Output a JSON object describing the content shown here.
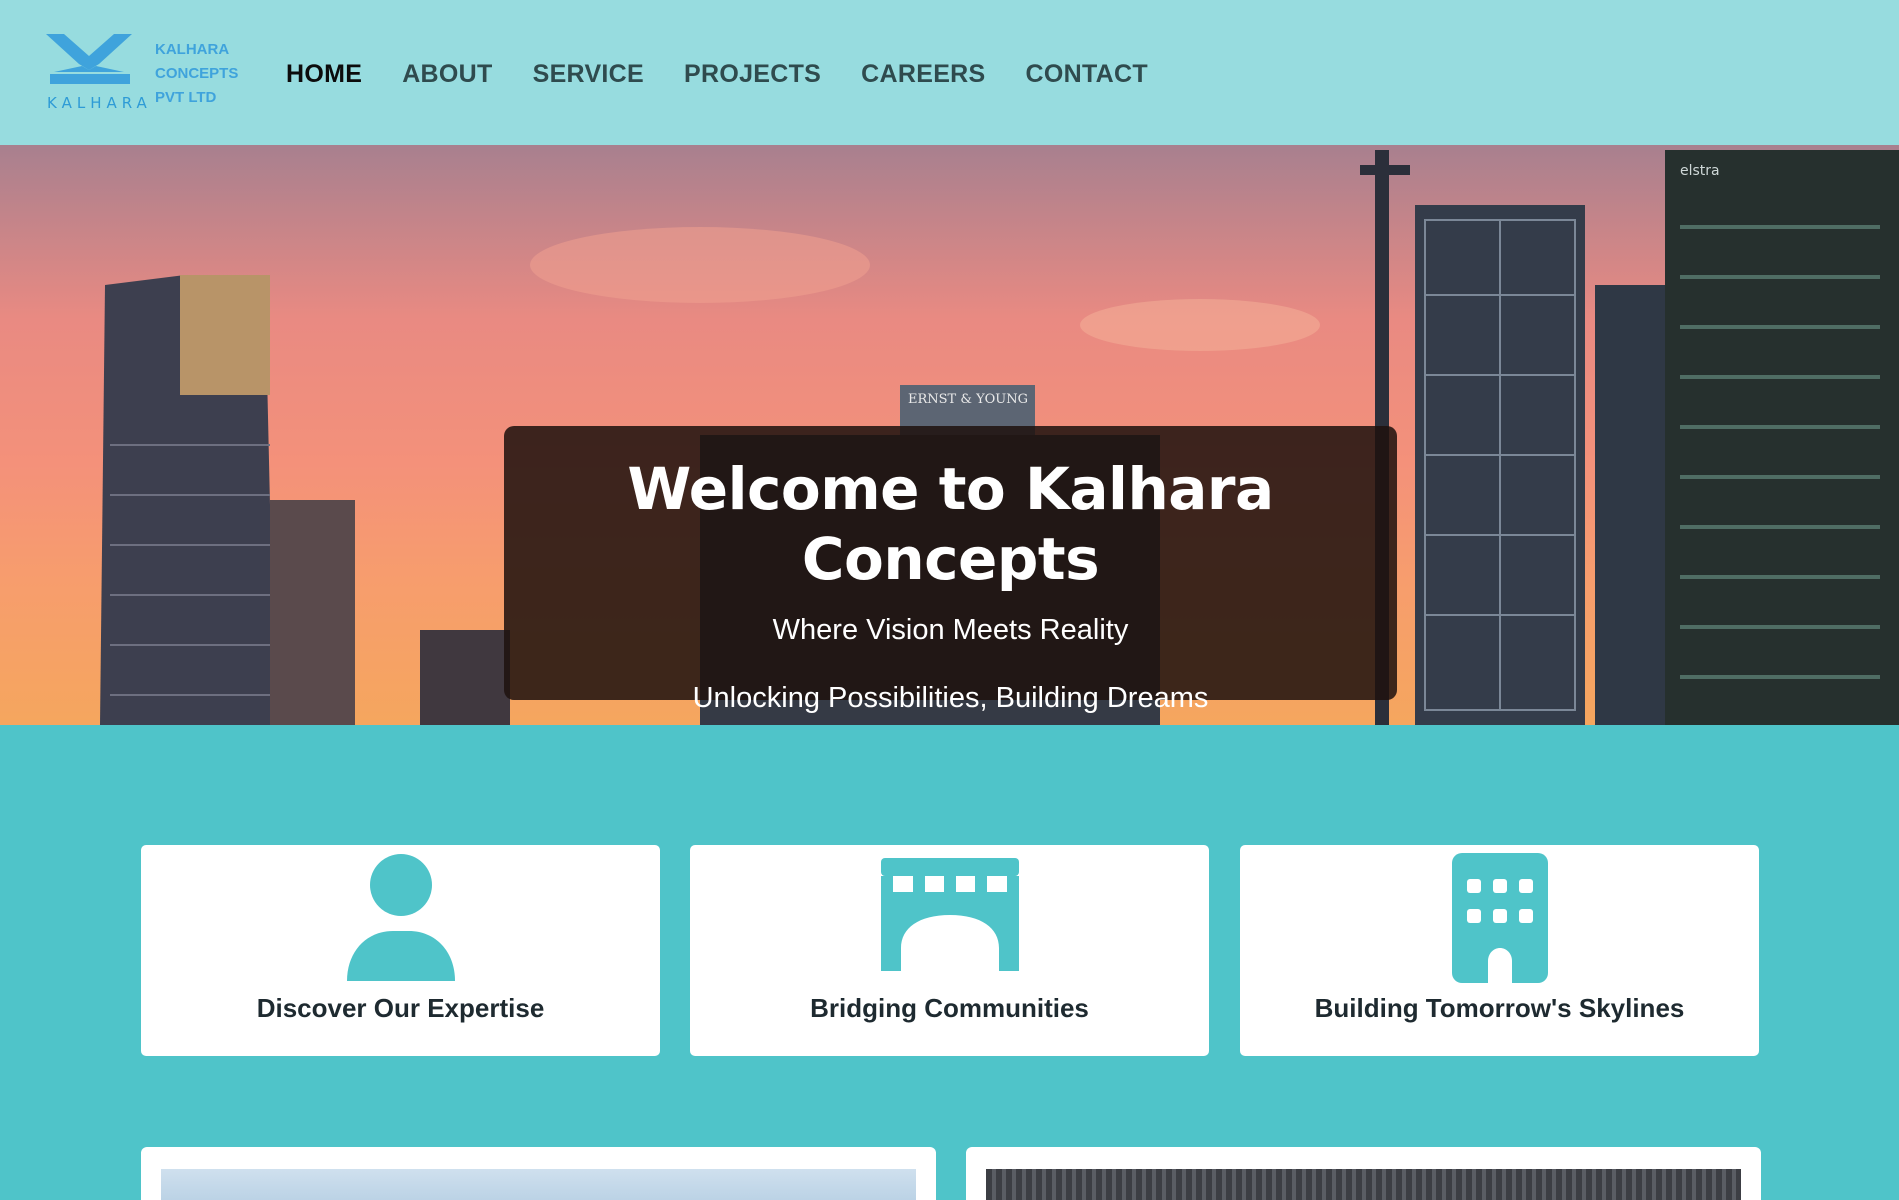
{
  "brand": {
    "logo_word": "KALHARA",
    "company_lines": [
      "KALHARA",
      "CONCEPTS",
      "PVT LTD"
    ],
    "logo_icon": "kalhara-x-mark-icon",
    "accent": "#3fa3dc"
  },
  "nav": {
    "items": [
      {
        "label": "HOME",
        "active": true
      },
      {
        "label": "ABOUT",
        "active": false
      },
      {
        "label": "SERVICE",
        "active": false
      },
      {
        "label": "PROJECTS",
        "active": false
      },
      {
        "label": "CAREERS",
        "active": false
      },
      {
        "label": "CONTACT",
        "active": false
      }
    ]
  },
  "hero": {
    "title": "Welcome to Kalhara Concepts",
    "tagline": "Where Vision Meets Reality",
    "subtitle": "Unlocking Possibilities, Building Dreams",
    "sign_text": "ERNST & YOUNG",
    "sign_text_2": "elstra"
  },
  "features": [
    {
      "label": "Discover Our Expertise",
      "icon": "person-icon"
    },
    {
      "label": "Bridging Communities",
      "icon": "bridge-icon"
    },
    {
      "label": "Building Tomorrow's Skylines",
      "icon": "building-icon"
    }
  ],
  "colors": {
    "header_bg": "#97dcdf",
    "page_bg": "#4fc4c9",
    "icon_teal": "#4fc4c9",
    "card_bg": "#ffffff"
  }
}
